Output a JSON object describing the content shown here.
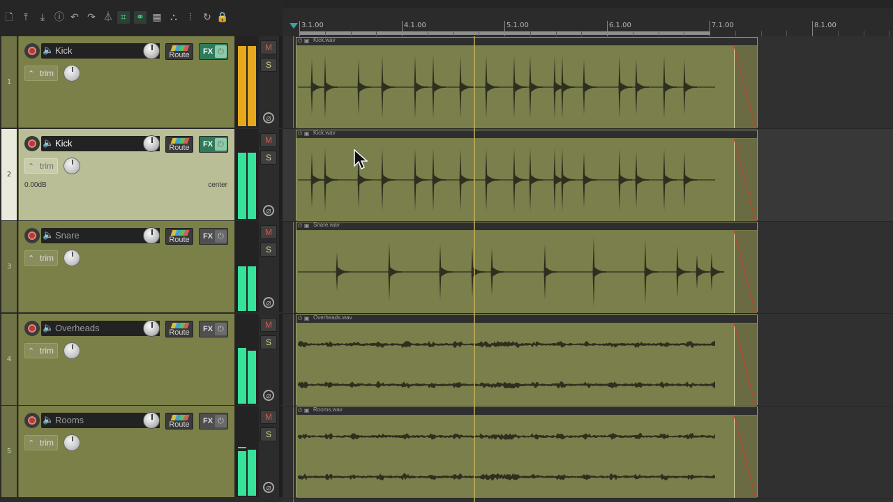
{
  "toolbar": {
    "buttons": [
      {
        "name": "new-project-icon",
        "glyph": "🗋"
      },
      {
        "name": "open-project-icon",
        "glyph": "⤒"
      },
      {
        "name": "save-project-icon",
        "glyph": "⤓"
      },
      {
        "name": "project-settings-icon",
        "glyph": "ⓘ"
      },
      {
        "name": "undo-icon",
        "glyph": "↶"
      },
      {
        "name": "redo-icon",
        "glyph": "↷"
      },
      {
        "name": "metronome-icon",
        "glyph": "⏃"
      },
      {
        "name": "ripple-edit-icon",
        "glyph": "⌗"
      },
      {
        "name": "item-grouping-icon",
        "glyph": "⚭"
      },
      {
        "name": "snap-grid-icon",
        "glyph": "▦"
      },
      {
        "name": "envelope-lock-icon",
        "glyph": "⛬"
      },
      {
        "name": "grid-lines-icon",
        "glyph": "⦙"
      },
      {
        "name": "loop-icon",
        "glyph": "↻"
      },
      {
        "name": "lock-icon",
        "glyph": "🔒"
      }
    ],
    "active": [
      "ripple-edit-icon",
      "item-grouping-icon"
    ]
  },
  "ruler": {
    "bars": [
      "3.1.00",
      "4.1.00",
      "5.1.00",
      "6.1.00",
      "7.1.00",
      "8.1.00"
    ]
  },
  "tracks": [
    {
      "number": "1",
      "name": "Kick",
      "route": "Route",
      "fx": "FX",
      "trim": "trim",
      "mute": "M",
      "solo": "S",
      "fx_active": true,
      "meter": "yellow",
      "item": "Kick.wav"
    },
    {
      "number": "2",
      "name": "Kick",
      "route": "Route",
      "fx": "FX",
      "trim": "trim",
      "mute": "M",
      "solo": "S",
      "fx_active": true,
      "meter": "green",
      "selected": true,
      "volume": "0.00dB",
      "pan": "center",
      "item": "Kick.wav"
    },
    {
      "number": "3",
      "name": "Snare",
      "route": "Route",
      "fx": "FX",
      "trim": "trim",
      "mute": "M",
      "solo": "S",
      "fx_active": false,
      "meter": "green",
      "item": "Snare.wav"
    },
    {
      "number": "4",
      "name": "Overheads",
      "route": "Route",
      "fx": "FX",
      "trim": "trim",
      "mute": "M",
      "solo": "S",
      "fx_active": false,
      "meter": "green",
      "item": "Overheads.wav"
    },
    {
      "number": "5",
      "name": "Rooms",
      "route": "Route",
      "fx": "FX",
      "trim": "trim",
      "mute": "M",
      "solo": "S",
      "fx_active": false,
      "meter": "green",
      "item": "Rooms.wav"
    }
  ],
  "colors": {
    "track_color": "#7b8049",
    "selected_track_color": "#b9be96",
    "meter_yellow": "#e8a81c",
    "meter_green": "#37e29a",
    "play_cursor": "#c8b25a"
  }
}
